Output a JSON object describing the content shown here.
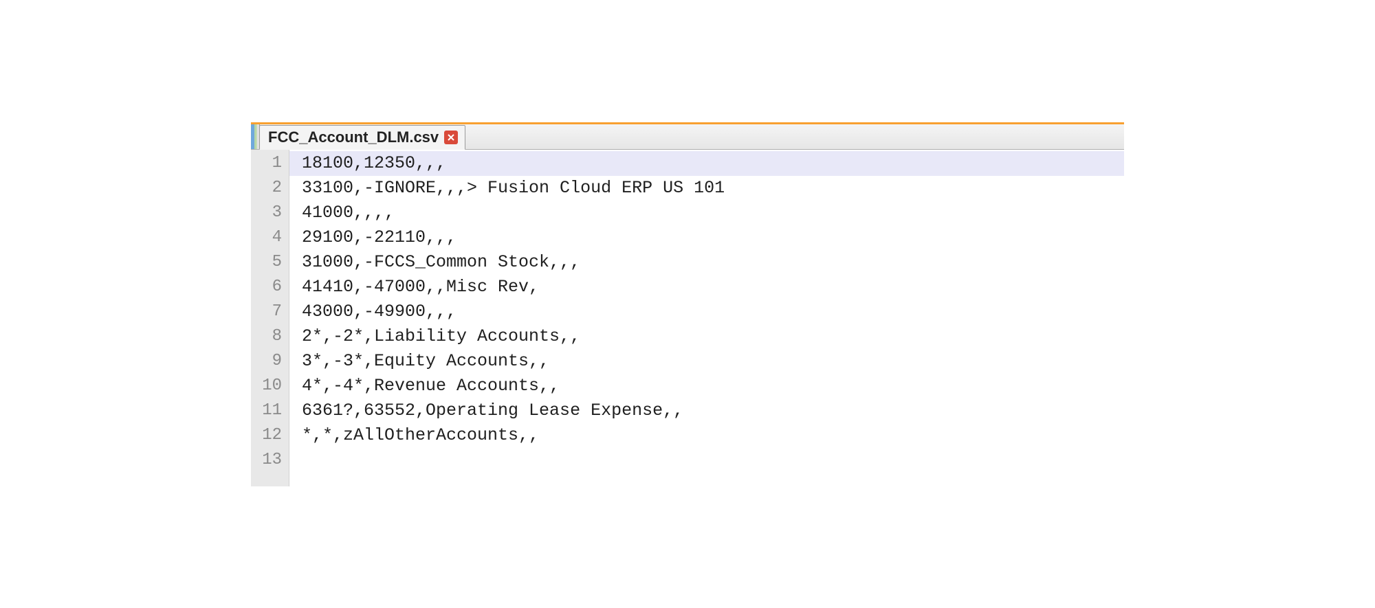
{
  "tab": {
    "title": "FCC_Account_DLM.csv"
  },
  "editor": {
    "highlighted_line": 1,
    "lines": [
      {
        "num": "1",
        "text": "18100,12350,,,"
      },
      {
        "num": "2",
        "text": "33100,-IGNORE,,,> Fusion Cloud ERP US 101"
      },
      {
        "num": "3",
        "text": "41000,,,,"
      },
      {
        "num": "4",
        "text": "29100,-22110,,,"
      },
      {
        "num": "5",
        "text": "31000,-FCCS_Common Stock,,,"
      },
      {
        "num": "6",
        "text": "41410,-47000,,Misc Rev,"
      },
      {
        "num": "7",
        "text": "43000,-49900,,,"
      },
      {
        "num": "8",
        "text": "2*,-2*,Liability Accounts,,"
      },
      {
        "num": "9",
        "text": "3*,-3*,Equity Accounts,,"
      },
      {
        "num": "10",
        "text": "4*,-4*,Revenue Accounts,,"
      },
      {
        "num": "11",
        "text": "6361?,63552,Operating Lease Expense,,"
      },
      {
        "num": "12",
        "text": "*,*,zAllOtherAccounts,,"
      },
      {
        "num": "13",
        "text": ""
      }
    ]
  }
}
